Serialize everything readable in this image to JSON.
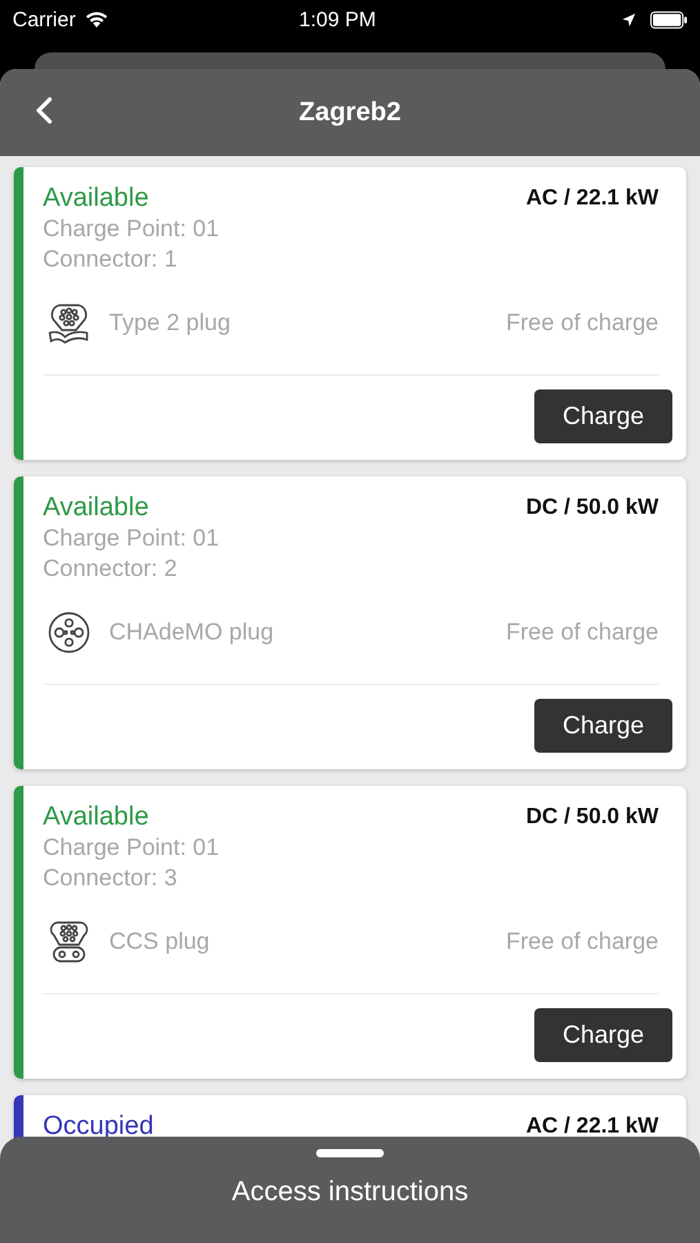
{
  "status_bar": {
    "carrier": "Carrier",
    "time": "1:09 PM"
  },
  "header": {
    "title": "Zagreb2"
  },
  "connectors": [
    {
      "status": "Available",
      "color": "#2e9a47",
      "power": "AC / 22.1 kW",
      "charge_point": "Charge Point: 01",
      "connector": "Connector: 1",
      "kind": "type2",
      "plug": "Type 2 plug",
      "price": "Free of charge",
      "button": "Charge"
    },
    {
      "status": "Available",
      "color": "#2e9a47",
      "power": "DC / 50.0 kW",
      "charge_point": "Charge Point: 01",
      "connector": "Connector: 2",
      "kind": "chademo",
      "plug": "CHAdeMO plug",
      "price": "Free of charge",
      "button": "Charge"
    },
    {
      "status": "Available",
      "color": "#2e9a47",
      "power": "DC / 50.0 kW",
      "charge_point": "Charge Point: 01",
      "connector": "Connector: 3",
      "kind": "ccs",
      "plug": "CCS plug",
      "price": "Free of charge",
      "button": "Charge"
    },
    {
      "status": "Occupied",
      "color": "#3636b8",
      "power": "AC / 22.1 kW"
    }
  ],
  "bottom_sheet": {
    "title": "Access instructions"
  }
}
